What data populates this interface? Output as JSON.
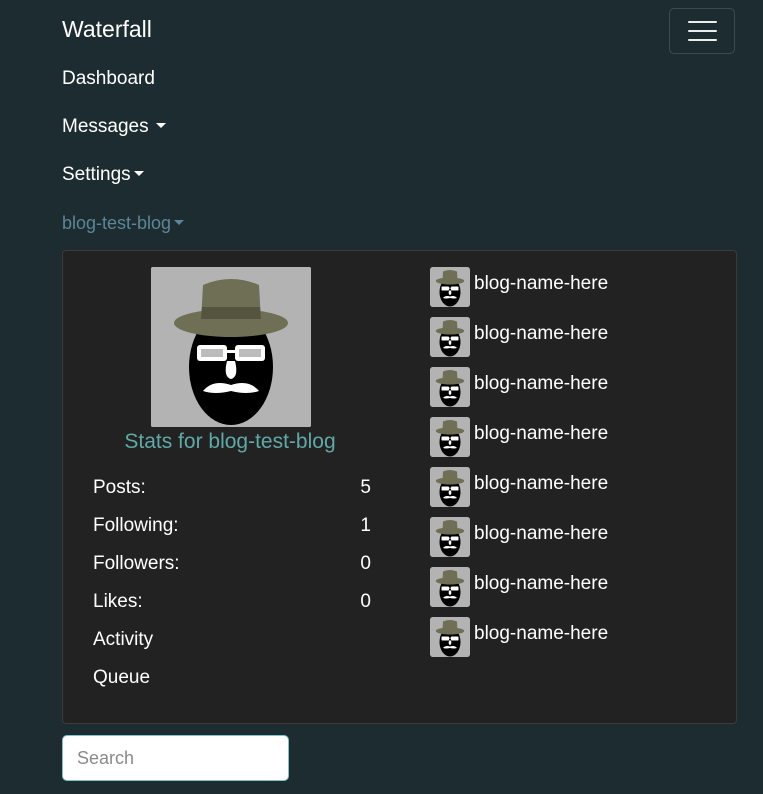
{
  "navbar": {
    "brand": "Waterfall",
    "toggler_icon": "hamburger-menu-icon",
    "items": [
      {
        "label": "Dashboard",
        "dropdown": false
      },
      {
        "label": "Messages",
        "dropdown": true
      },
      {
        "label": "Settings",
        "dropdown": true
      },
      {
        "label": "blog-test-blog",
        "dropdown": true
      }
    ]
  },
  "blog_panel": {
    "avatar_icon": "hat-mustache-avatar-icon",
    "stats_title": "Stats for blog-test-blog",
    "stats": [
      {
        "label": "Posts:",
        "value": "5"
      },
      {
        "label": "Following:",
        "value": "1"
      },
      {
        "label": "Followers:",
        "value": "0"
      },
      {
        "label": "Likes:",
        "value": "0"
      },
      {
        "label": "Activity",
        "value": ""
      },
      {
        "label": "Queue",
        "value": ""
      }
    ],
    "followed_blogs": [
      {
        "name": "blog-name-here"
      },
      {
        "name": "blog-name-here"
      },
      {
        "name": "blog-name-here"
      },
      {
        "name": "blog-name-here"
      },
      {
        "name": "blog-name-here"
      },
      {
        "name": "blog-name-here"
      },
      {
        "name": "blog-name-here"
      },
      {
        "name": "blog-name-here"
      }
    ]
  },
  "search": {
    "placeholder": "Search",
    "value": ""
  },
  "colors": {
    "background": "#1d2c30",
    "panel": "#222222",
    "accent_teal": "#5fa9a7",
    "blog_link": "#5b8697"
  }
}
